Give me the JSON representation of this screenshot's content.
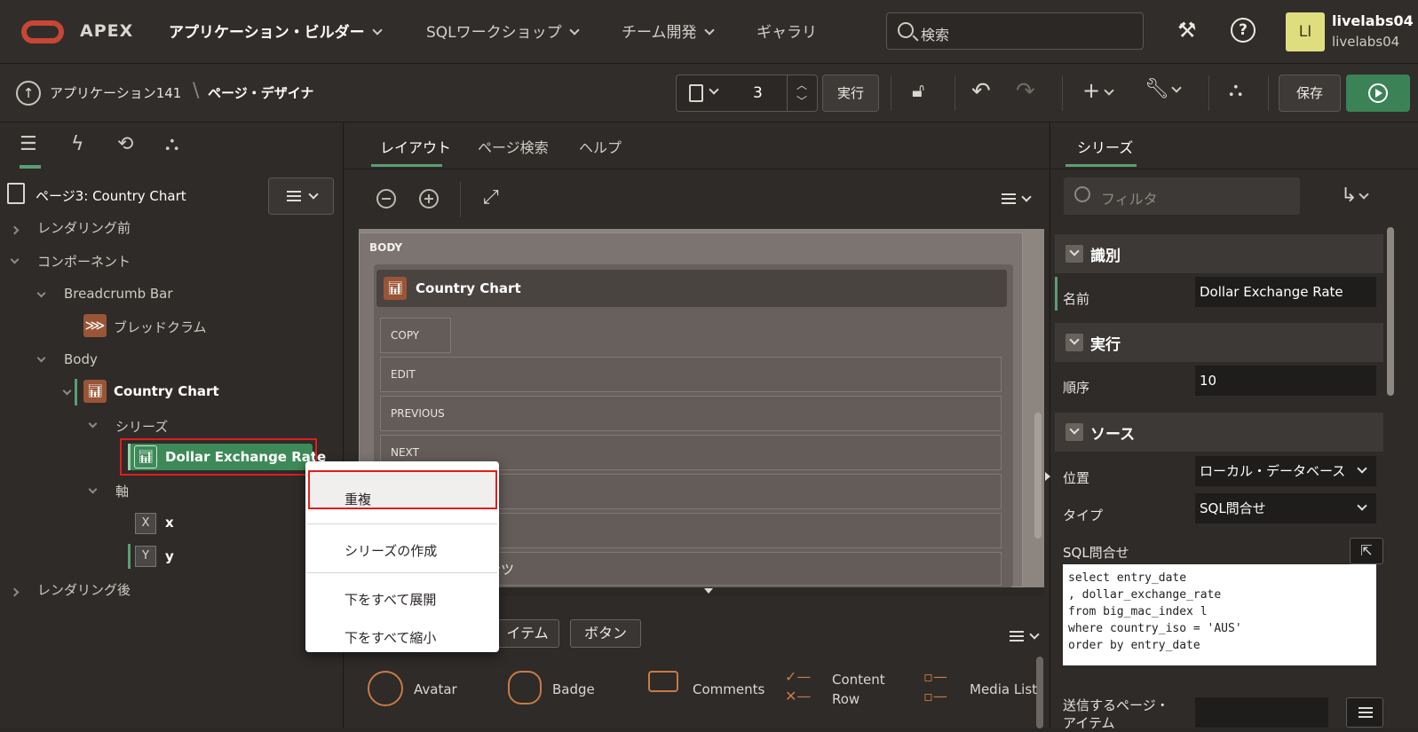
{
  "header": {
    "brand": "APEX",
    "nav": [
      {
        "label": "アプリケーション・ビルダー",
        "active": true
      },
      {
        "label": "SQLワークショップ",
        "active": false
      },
      {
        "label": "チーム開発",
        "active": false
      },
      {
        "label": "ギャラリ",
        "active": false
      }
    ],
    "search_placeholder": "検索",
    "user": {
      "initials": "LI",
      "name": "livelabs04",
      "workspace": "livelabs04"
    }
  },
  "toolbar": {
    "breadcrumb_app": "アプリケーション141",
    "breadcrumb_page": "ページ・デザイナ",
    "page_number": "3",
    "run_label": "実行",
    "save_label": "保存"
  },
  "tree": {
    "page_title": "ページ3: Country Chart",
    "before_render": "レンダリング前",
    "components": "コンポーネント",
    "breadcrumb_bar": "Breadcrumb Bar",
    "breadcrumb": "ブレッドクラム",
    "body": "Body",
    "country_chart": "Country Chart",
    "series": "シリーズ",
    "dollar_rate": "Dollar Exchange Rate",
    "axes": "軸",
    "axis_x": "x",
    "axis_y": "y",
    "after_render": "レンダリング後"
  },
  "context_menu": {
    "duplicate": "重複",
    "create_series": "シリーズの作成",
    "expand_all": "下をすべて展開",
    "collapse_all": "下をすべて縮小"
  },
  "middle": {
    "tabs": [
      "レイアウト",
      "ページ検索",
      "ヘルプ"
    ],
    "body_label": "BODY",
    "region_title": "Country Chart",
    "slots": [
      "COPY",
      "EDIT",
      "PREVIOUS",
      "NEXT"
    ],
    "partial_slot": "ンツ",
    "gallery_tabs": [
      "イテム",
      "ボタン"
    ],
    "gallery_items": [
      "Avatar",
      "Badge",
      "Comments",
      "Content",
      "Row",
      "Media List"
    ]
  },
  "properties": {
    "tab": "シリーズ",
    "filter_placeholder": "フィルタ",
    "sections": {
      "identification": "識別",
      "execution": "実行",
      "source": "ソース"
    },
    "name_label": "名前",
    "name_value": "Dollar Exchange Rate",
    "sequence_label": "順序",
    "sequence_value": "10",
    "location_label": "位置",
    "location_value": "ローカル・データベース",
    "type_label": "タイプ",
    "type_value": "SQL問合せ",
    "sql_label": "SQL問合せ",
    "sql_text": "select entry_date\n, dollar_exchange_rate\nfrom big_mac_index l\nwhere country_iso = 'AUS'\norder by entry_date",
    "submit_label_1": "送信するページ・",
    "submit_label_2": "アイテム"
  },
  "colors": {
    "accent": "#3b8256",
    "highlight": "#e21d1d",
    "brand": "#c74634"
  }
}
